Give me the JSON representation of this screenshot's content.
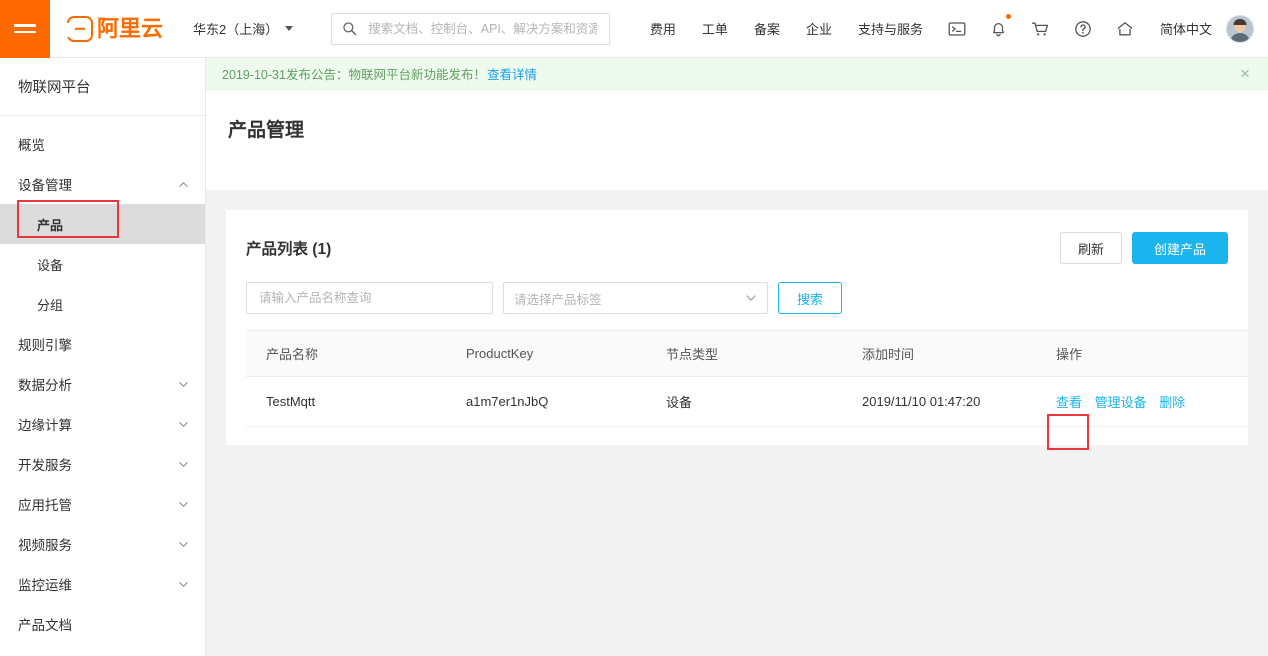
{
  "header": {
    "menu_icon": "hamburger-icon",
    "logo_text": "阿里云",
    "region": "华东2（上海）",
    "search_placeholder": "搜索文档、控制台、API、解决方案和资源",
    "search_value": "",
    "nav_links": [
      "费用",
      "工单",
      "备案",
      "企业",
      "支持与服务"
    ],
    "icons": [
      "terminal-icon",
      "bell-icon",
      "cart-icon",
      "help-icon",
      "home-icon"
    ],
    "language": "简体中文",
    "avatar": "user-avatar"
  },
  "notice": {
    "text": "2019-10-31发布公告：物联网平台新功能发布！",
    "link": "查看详情",
    "close": "×",
    "background": "#effaef",
    "text_color": "#5fa05f",
    "link_color": "#1ca1f2"
  },
  "sidebar": {
    "title": "物联网平台",
    "items": [
      {
        "label": "概览",
        "level": "top",
        "expandable": false,
        "chevron": "",
        "active": false
      },
      {
        "label": "设备管理",
        "level": "top",
        "expandable": true,
        "chevron": "chevron-up-icon",
        "active": false
      },
      {
        "label": "产品",
        "level": "sub",
        "expandable": false,
        "chevron": "",
        "active": true
      },
      {
        "label": "设备",
        "level": "sub",
        "expandable": false,
        "chevron": "",
        "active": false
      },
      {
        "label": "分组",
        "level": "sub",
        "expandable": false,
        "chevron": "",
        "active": false
      },
      {
        "label": "规则引擎",
        "level": "top",
        "expandable": false,
        "chevron": "",
        "active": false
      },
      {
        "label": "数据分析",
        "level": "top",
        "expandable": true,
        "chevron": "chevron-down-icon",
        "active": false
      },
      {
        "label": "边缘计算",
        "level": "top",
        "expandable": true,
        "chevron": "chevron-down-icon",
        "active": false
      },
      {
        "label": "开发服务",
        "level": "top",
        "expandable": true,
        "chevron": "chevron-down-icon",
        "active": false
      },
      {
        "label": "应用托管",
        "level": "top",
        "expandable": true,
        "chevron": "chevron-down-icon",
        "active": false
      },
      {
        "label": "视频服务",
        "level": "top",
        "expandable": true,
        "chevron": "chevron-down-icon",
        "active": false
      },
      {
        "label": "监控运维",
        "level": "top",
        "expandable": true,
        "chevron": "chevron-down-icon",
        "active": false
      },
      {
        "label": "产品文档",
        "level": "top",
        "expandable": false,
        "chevron": "",
        "active": false
      }
    ]
  },
  "main": {
    "page_title": "产品管理",
    "card_title": "产品列表 (1)",
    "refresh_button": "刷新",
    "create_button": "创建产品",
    "filters": {
      "name_placeholder": "请输入产品名称查询",
      "name_value": "",
      "tag_placeholder": "请选择产品标签",
      "tag_value": "",
      "search_button": "搜索"
    },
    "table": {
      "columns": [
        "产品名称",
        "ProductKey",
        "节点类型",
        "添加时间",
        "操作"
      ],
      "rows": [
        {
          "name": "TestMqtt",
          "product_key": "a1m7er1nJbQ",
          "node_type": "设备",
          "created_at": "2019/11/10 01:47:20",
          "actions": [
            "查看",
            "管理设备",
            "删除"
          ]
        }
      ]
    }
  },
  "highlights": {
    "color": "#e8373d",
    "boxes": [
      "sidebar-item-product",
      "row-action-view"
    ]
  },
  "colors": {
    "brand_orange": "#ff6a00",
    "primary_blue": "#1ab5ef",
    "page_background": "#f2f2f2",
    "active_menu_background": "#dcdcdc"
  }
}
